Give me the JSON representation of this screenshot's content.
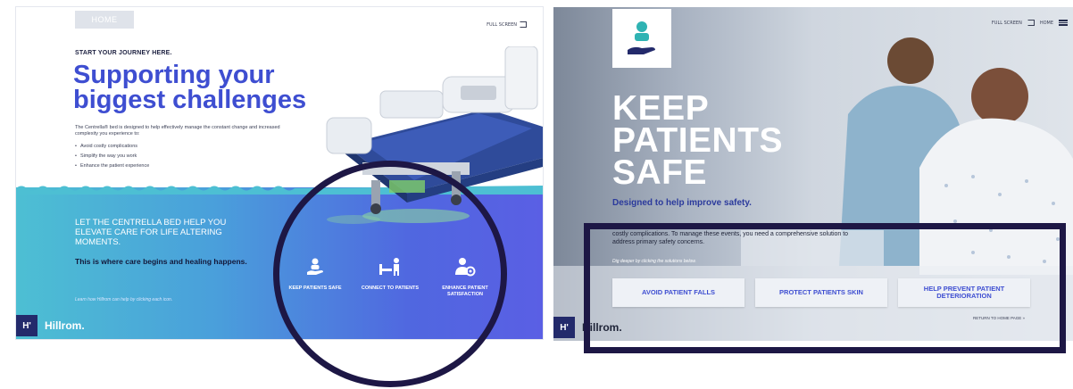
{
  "left_screen": {
    "home_tab": "HOME",
    "full_screen": "FULL SCREEN",
    "eyebrow": "START YOUR JOURNEY HERE.",
    "headline": "Supporting your biggest challenges",
    "intro": "The Centrella® bed is designed to help effectively manage the constant change and increased complexity you experience to:",
    "bullets": [
      "Avoid costly complications",
      "Simplify the way you work",
      "Enhance the patient experience"
    ],
    "cta": "LET THE CENTRELLA BED HELP YOU ELEVATE CARE FOR LIFE ALTERING MOMENTS.",
    "tagline": "This is where care begins and healing happens.",
    "learn_hint": "Learn how Hillrom can help by clicking each icon.",
    "features": [
      {
        "label": "KEEP PATIENTS SAFE",
        "icon": "hand-holding-person-icon"
      },
      {
        "label": "CONNECT TO PATIENTS",
        "icon": "bed-connect-icon"
      },
      {
        "label": "ENHANCE PATIENT SATISFACTION",
        "icon": "person-gear-icon"
      }
    ],
    "logo": "Hillrom."
  },
  "right_screen": {
    "full_screen": "FULL SCREEN",
    "home": "HOME",
    "title": "KEEP PATIENTS SAFE",
    "subtitle": "Designed to help improve safety.",
    "body": "costly complications. To manage these events, you need a comprehensive solution to address primary safety concerns.",
    "dig_hint": "Dig deeper by clicking the solutions below.",
    "buttons": [
      "AVOID PATIENT FALLS",
      "PROTECT PATIENTS SKIN",
      "HELP PREVENT PATIENT DETERIORATION"
    ],
    "return_link": "RETURN TO HOME PAGE »",
    "logo": "Hillrom."
  },
  "colors": {
    "brand_blue": "#3e4ed1",
    "navy": "#232a6b",
    "annotation": "#1d1745",
    "band_start": "#4dbfd3",
    "band_end": "#5a5fe4"
  }
}
